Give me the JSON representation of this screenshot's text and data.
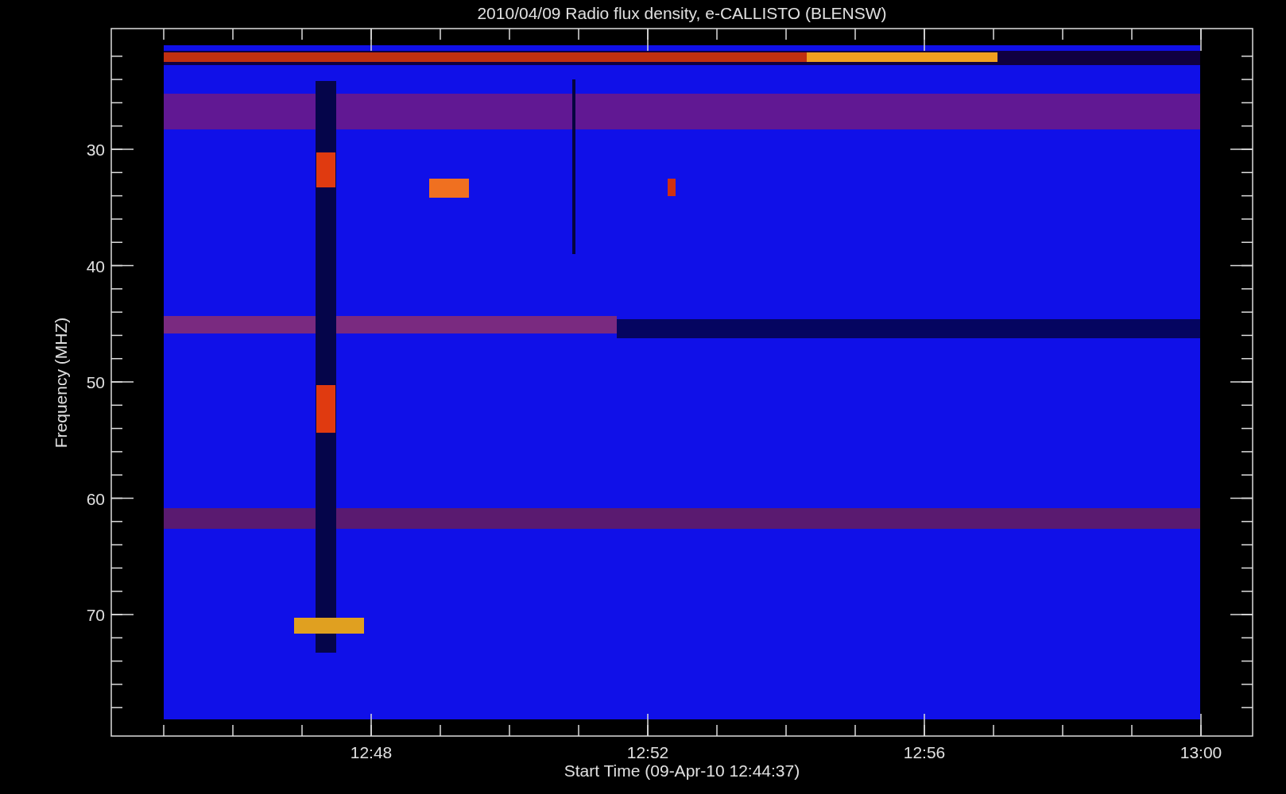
{
  "title": "2010/04/09  Radio flux density, e-CALLISTO (BLENSW)",
  "y_axis": {
    "label": "Frequency (MHZ)",
    "ticks": [
      "30",
      "40",
      "50",
      "60",
      "70"
    ]
  },
  "x_axis": {
    "label": "Start Time (09-Apr-10 12:44:37)",
    "ticks": [
      "12:48",
      "12:52",
      "12:56",
      "13:00"
    ]
  }
}
